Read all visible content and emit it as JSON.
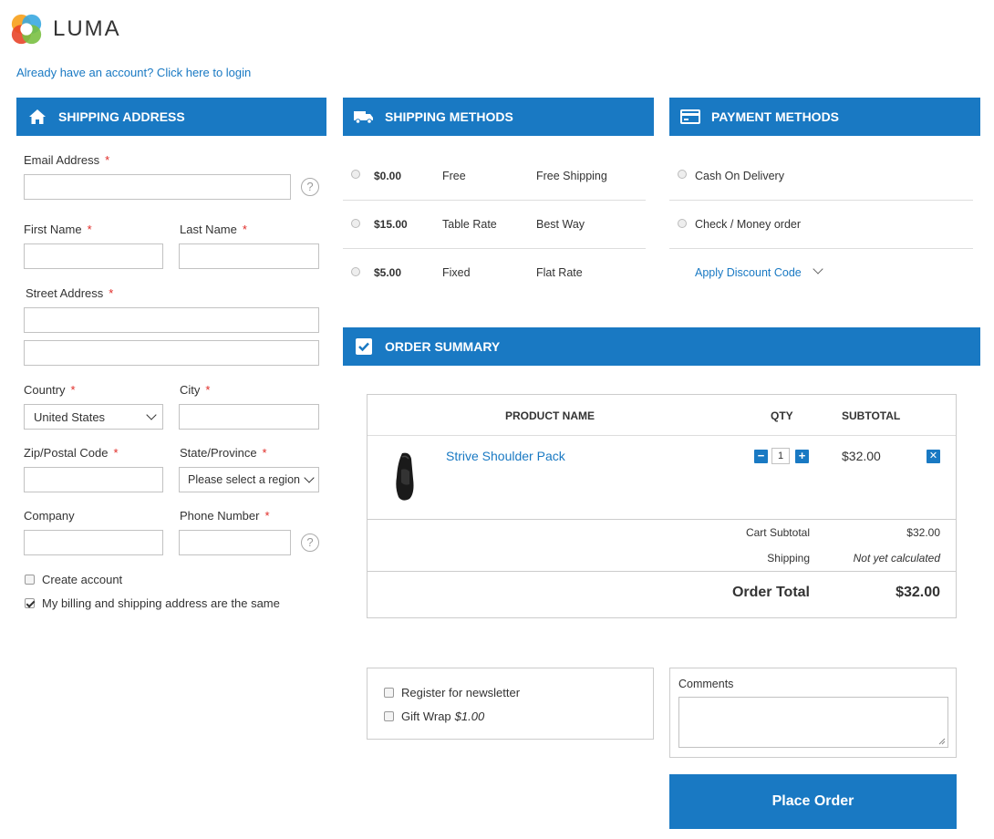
{
  "brand": {
    "name": "LUMA"
  },
  "login_prompt": "Already have an account? Click here to login",
  "shipping_address": {
    "title": "SHIPPING ADDRESS",
    "icon": "home-icon",
    "email_label": "Email Address",
    "first_name_label": "First Name",
    "last_name_label": "Last Name",
    "street_label": "Street Address",
    "country_label": "Country",
    "country_value": "United States",
    "city_label": "City",
    "zip_label": "Zip/Postal Code",
    "state_label": "State/Province",
    "state_value": "Please select a region",
    "company_label": "Company",
    "phone_label": "Phone Number",
    "required_mark": "*",
    "help_mark": "?",
    "create_account_label": "Create account",
    "same_address_label": "My billing and shipping address are the same"
  },
  "shipping_methods": {
    "title": "SHIPPING METHODS",
    "icon": "truck-icon",
    "options": [
      {
        "price": "$0.00",
        "method": "Free",
        "carrier": "Free Shipping"
      },
      {
        "price": "$15.00",
        "method": "Table Rate",
        "carrier": "Best Way"
      },
      {
        "price": "$5.00",
        "method": "Fixed",
        "carrier": "Flat Rate"
      }
    ]
  },
  "payment_methods": {
    "title": "PAYMENT METHODS",
    "icon": "credit-card-icon",
    "options": [
      "Cash On Delivery",
      "Check / Money order"
    ],
    "discount_link": "Apply Discount Code"
  },
  "order_summary": {
    "title": "ORDER SUMMARY",
    "icon": "checkbox-icon",
    "headers": {
      "product": "PRODUCT NAME",
      "qty": "QTY",
      "subtotal": "SUBTOTAL"
    },
    "item": {
      "name": "Strive Shoulder Pack",
      "qty": "1",
      "subtotal": "$32.00"
    },
    "cart_subtotal_label": "Cart Subtotal",
    "cart_subtotal_value": "$32.00",
    "shipping_label": "Shipping",
    "shipping_value": "Not yet calculated",
    "order_total_label": "Order Total",
    "order_total_value": "$32.00"
  },
  "extras": {
    "newsletter_label": "Register for newsletter",
    "gift_wrap_label": "Gift Wrap",
    "gift_wrap_price": "$1.00",
    "comments_label": "Comments"
  },
  "place_order_label": "Place Order",
  "colors": {
    "accent": "#1979c3",
    "required": "#e02b27"
  }
}
